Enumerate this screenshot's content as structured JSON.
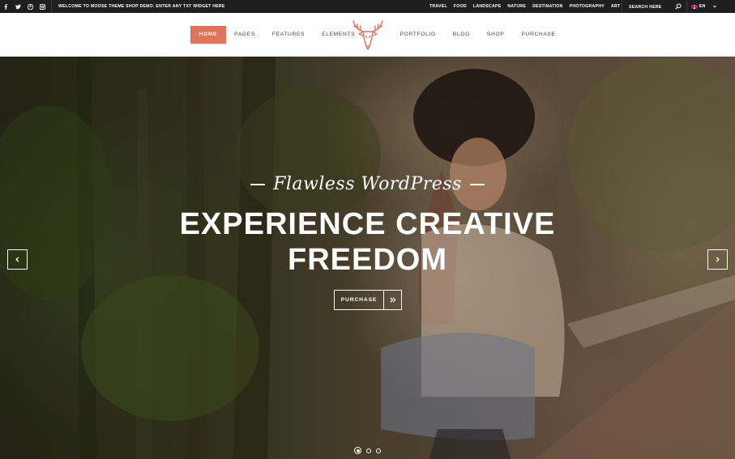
{
  "topbar": {
    "social": [
      "facebook-icon",
      "twitter-icon",
      "pinterest-icon",
      "instagram-icon"
    ],
    "welcome": "WELCOME TO MOOSE THEME SHOP DEMO. ENTER ANY TXT WIDGET HERE",
    "categories": [
      "TRAVEL",
      "FOOD",
      "LANDSCAPE",
      "NATURE",
      "DESTINATION",
      "PHOTOGRAPHY",
      "ART"
    ],
    "search_placeholder": "SEARCH HERE",
    "language": "EN"
  },
  "nav": {
    "left": [
      "HOME",
      "PAGES",
      "FEATURES",
      "ELEMENTS"
    ],
    "right": [
      "PORTFOLIO",
      "BLOG",
      "SHOP",
      "PURCHASE"
    ],
    "active": "HOME",
    "accent": "#e2735b"
  },
  "hero": {
    "script": "Flawless WordPress",
    "title_line1": "EXPERIENCE CREATIVE",
    "title_line2": "FREEDOM",
    "button": "PURCHASE",
    "slides_total": 3,
    "slide_active": 1
  }
}
